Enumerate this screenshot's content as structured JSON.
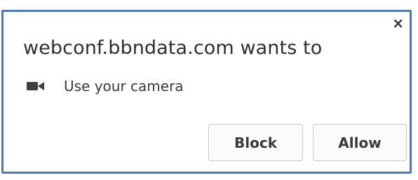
{
  "dialog": {
    "title": "webconf.bbndata.com wants to",
    "close_symbol": "×",
    "permission": {
      "icon": "video-camera-icon",
      "label": "Use your camera"
    },
    "buttons": {
      "block_label": "Block",
      "allow_label": "Allow"
    },
    "colors": {
      "border": "#4a7ab8",
      "text": "#2e2e2e",
      "button_bg": "#fbfbfb"
    }
  }
}
